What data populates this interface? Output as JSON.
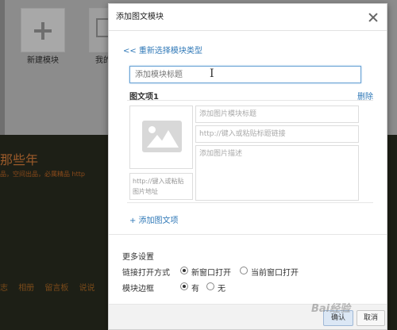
{
  "background": {
    "tile1_label": "新建模块",
    "tile2_label": "我的",
    "site_title": "那些年",
    "site_subtitle": "品，空间出品，必属精品   http",
    "nav_items": [
      "志",
      "相册",
      "留言板",
      "说说"
    ]
  },
  "dialog": {
    "title": "添加图文模块",
    "back_link": "<< 重新选择模块类型",
    "title_input_placeholder": "添加模块标题",
    "item": {
      "section_title": "图文项1",
      "delete_label": "删除",
      "image_url_placeholder": "http://键入或粘贴图片地址",
      "image_title_placeholder": "添加图片模块标题",
      "link_placeholder": "http://键入或粘贴标题链接",
      "desc_placeholder": "添加图片描述"
    },
    "add_item_label": "+ 添加图文项",
    "more_settings": {
      "title": "更多设置",
      "link_open_label": "链接打开方式",
      "link_open_options": [
        "新窗口打开",
        "当前窗口打开"
      ],
      "link_open_selected": "新窗口打开",
      "border_label": "模块边框",
      "border_options": [
        "有",
        "无"
      ],
      "border_selected": "有"
    },
    "ok_label": "确认",
    "cancel_label": "取消"
  },
  "watermark": "Bai经验"
}
